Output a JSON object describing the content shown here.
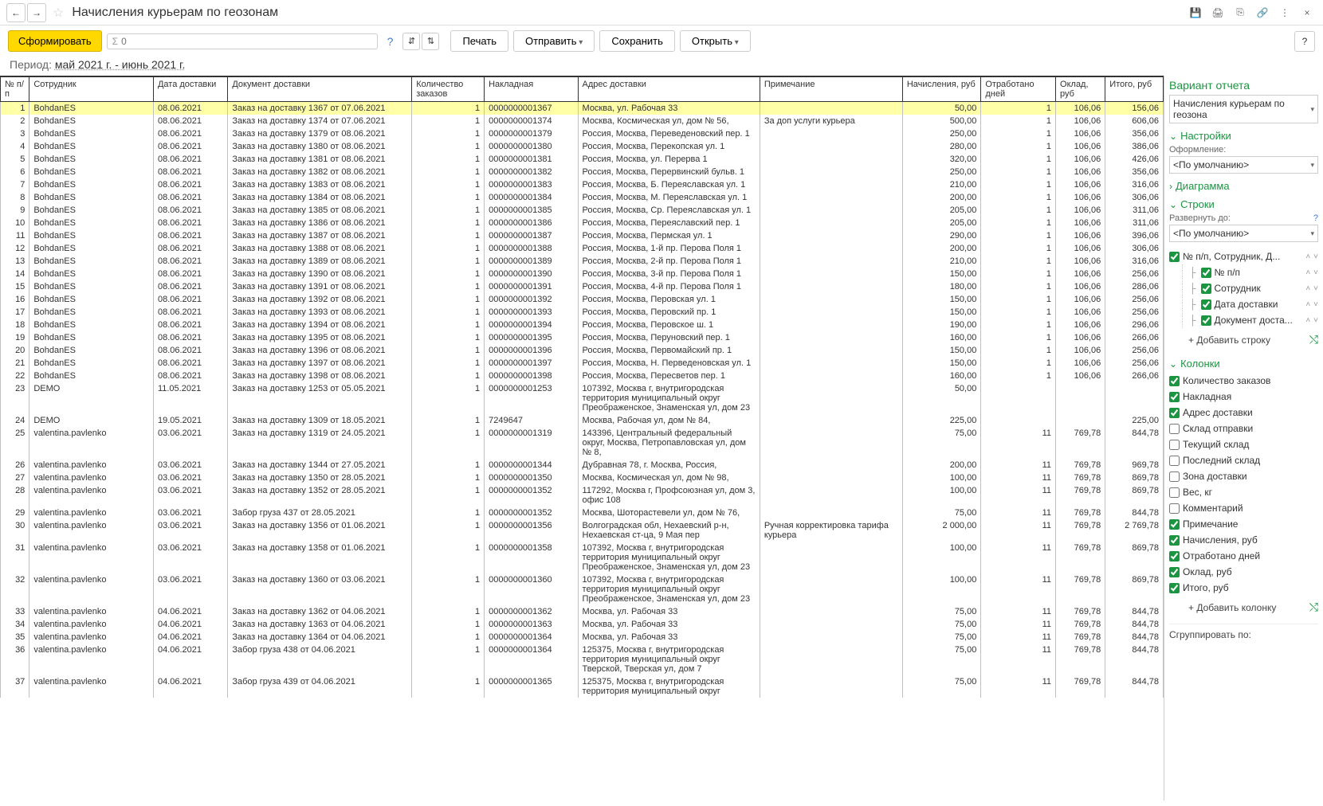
{
  "header": {
    "title": "Начисления курьерам по геозонам"
  },
  "toolbar": {
    "form": "Сформировать",
    "search_placeholder": "0",
    "print": "Печать",
    "send": "Отправить",
    "save": "Сохранить",
    "open": "Открыть"
  },
  "period": {
    "label": "Период:",
    "value": "май 2021 г. - июнь 2021 г."
  },
  "columns": {
    "num": "№ п/п",
    "emp": "Сотрудник",
    "date": "Дата доставки",
    "doc": "Документ доставки",
    "qty": "Количество заказов",
    "inv": "Накладная",
    "addr": "Адрес доставки",
    "note": "Примечание",
    "acc": "Начисления, руб",
    "days": "Отработано дней",
    "sal": "Оклад, руб",
    "total": "Итого, руб"
  },
  "rows": [
    {
      "n": 1,
      "emp": "BohdanES",
      "date": "08.06.2021",
      "doc": "Заказ на доставку 1367 от 07.06.2021",
      "qty": 1,
      "inv": "0000000001367",
      "addr": "Москва, ул. Рабочая 33",
      "note": "",
      "acc": "50,00",
      "days": 1,
      "sal": "106,06",
      "total": "156,06",
      "hl": true
    },
    {
      "n": 2,
      "emp": "BohdanES",
      "date": "08.06.2021",
      "doc": "Заказ на доставку 1374 от 07.06.2021",
      "qty": 1,
      "inv": "0000000001374",
      "addr": "Москва, Космическая ул, дом № 56,",
      "note": "За доп услуги курьера",
      "acc": "500,00",
      "days": 1,
      "sal": "106,06",
      "total": "606,06"
    },
    {
      "n": 3,
      "emp": "BohdanES",
      "date": "08.06.2021",
      "doc": "Заказ на доставку 1379 от 08.06.2021",
      "qty": 1,
      "inv": "0000000001379",
      "addr": "Россия, Москва, Переведеновский пер. 1",
      "note": "",
      "acc": "250,00",
      "days": 1,
      "sal": "106,06",
      "total": "356,06"
    },
    {
      "n": 4,
      "emp": "BohdanES",
      "date": "08.06.2021",
      "doc": "Заказ на доставку 1380 от 08.06.2021",
      "qty": 1,
      "inv": "0000000001380",
      "addr": "Россия, Москва, Перекопская ул. 1",
      "note": "",
      "acc": "280,00",
      "days": 1,
      "sal": "106,06",
      "total": "386,06"
    },
    {
      "n": 5,
      "emp": "BohdanES",
      "date": "08.06.2021",
      "doc": "Заказ на доставку 1381 от 08.06.2021",
      "qty": 1,
      "inv": "0000000001381",
      "addr": "Россия, Москва, ул. Перерва 1",
      "note": "",
      "acc": "320,00",
      "days": 1,
      "sal": "106,06",
      "total": "426,06"
    },
    {
      "n": 6,
      "emp": "BohdanES",
      "date": "08.06.2021",
      "doc": "Заказ на доставку 1382 от 08.06.2021",
      "qty": 1,
      "inv": "0000000001382",
      "addr": "Россия, Москва, Перервинский бульв. 1",
      "note": "",
      "acc": "250,00",
      "days": 1,
      "sal": "106,06",
      "total": "356,06"
    },
    {
      "n": 7,
      "emp": "BohdanES",
      "date": "08.06.2021",
      "doc": "Заказ на доставку 1383 от 08.06.2021",
      "qty": 1,
      "inv": "0000000001383",
      "addr": "Россия, Москва, Б. Переяславская ул. 1",
      "note": "",
      "acc": "210,00",
      "days": 1,
      "sal": "106,06",
      "total": "316,06"
    },
    {
      "n": 8,
      "emp": "BohdanES",
      "date": "08.06.2021",
      "doc": "Заказ на доставку 1384 от 08.06.2021",
      "qty": 1,
      "inv": "0000000001384",
      "addr": "Россия, Москва, М. Переяславская ул. 1",
      "note": "",
      "acc": "200,00",
      "days": 1,
      "sal": "106,06",
      "total": "306,06"
    },
    {
      "n": 9,
      "emp": "BohdanES",
      "date": "08.06.2021",
      "doc": "Заказ на доставку 1385 от 08.06.2021",
      "qty": 1,
      "inv": "0000000001385",
      "addr": "Россия, Москва, Ср. Переяславская ул. 1",
      "note": "",
      "acc": "205,00",
      "days": 1,
      "sal": "106,06",
      "total": "311,06"
    },
    {
      "n": 10,
      "emp": "BohdanES",
      "date": "08.06.2021",
      "doc": "Заказ на доставку 1386 от 08.06.2021",
      "qty": 1,
      "inv": "0000000001386",
      "addr": "Россия, Москва, Переяславский пер. 1",
      "note": "",
      "acc": "205,00",
      "days": 1,
      "sal": "106,06",
      "total": "311,06"
    },
    {
      "n": 11,
      "emp": "BohdanES",
      "date": "08.06.2021",
      "doc": "Заказ на доставку 1387 от 08.06.2021",
      "qty": 1,
      "inv": "0000000001387",
      "addr": "Россия, Москва, Пермская ул. 1",
      "note": "",
      "acc": "290,00",
      "days": 1,
      "sal": "106,06",
      "total": "396,06"
    },
    {
      "n": 12,
      "emp": "BohdanES",
      "date": "08.06.2021",
      "doc": "Заказ на доставку 1388 от 08.06.2021",
      "qty": 1,
      "inv": "0000000001388",
      "addr": "Россия, Москва, 1-й пр. Перова Поля 1",
      "note": "",
      "acc": "200,00",
      "days": 1,
      "sal": "106,06",
      "total": "306,06"
    },
    {
      "n": 13,
      "emp": "BohdanES",
      "date": "08.06.2021",
      "doc": "Заказ на доставку 1389 от 08.06.2021",
      "qty": 1,
      "inv": "0000000001389",
      "addr": "Россия, Москва, 2-й пр. Перова Поля 1",
      "note": "",
      "acc": "210,00",
      "days": 1,
      "sal": "106,06",
      "total": "316,06"
    },
    {
      "n": 14,
      "emp": "BohdanES",
      "date": "08.06.2021",
      "doc": "Заказ на доставку 1390 от 08.06.2021",
      "qty": 1,
      "inv": "0000000001390",
      "addr": "Россия, Москва, 3-й пр. Перова Поля 1",
      "note": "",
      "acc": "150,00",
      "days": 1,
      "sal": "106,06",
      "total": "256,06"
    },
    {
      "n": 15,
      "emp": "BohdanES",
      "date": "08.06.2021",
      "doc": "Заказ на доставку 1391 от 08.06.2021",
      "qty": 1,
      "inv": "0000000001391",
      "addr": "Россия, Москва, 4-й пр. Перова Поля 1",
      "note": "",
      "acc": "180,00",
      "days": 1,
      "sal": "106,06",
      "total": "286,06"
    },
    {
      "n": 16,
      "emp": "BohdanES",
      "date": "08.06.2021",
      "doc": "Заказ на доставку 1392 от 08.06.2021",
      "qty": 1,
      "inv": "0000000001392",
      "addr": "Россия, Москва, Перовская ул. 1",
      "note": "",
      "acc": "150,00",
      "days": 1,
      "sal": "106,06",
      "total": "256,06"
    },
    {
      "n": 17,
      "emp": "BohdanES",
      "date": "08.06.2021",
      "doc": "Заказ на доставку 1393 от 08.06.2021",
      "qty": 1,
      "inv": "0000000001393",
      "addr": "Россия, Москва, Перовский пр. 1",
      "note": "",
      "acc": "150,00",
      "days": 1,
      "sal": "106,06",
      "total": "256,06"
    },
    {
      "n": 18,
      "emp": "BohdanES",
      "date": "08.06.2021",
      "doc": "Заказ на доставку 1394 от 08.06.2021",
      "qty": 1,
      "inv": "0000000001394",
      "addr": "Россия, Москва, Перовское ш. 1",
      "note": "",
      "acc": "190,00",
      "days": 1,
      "sal": "106,06",
      "total": "296,06"
    },
    {
      "n": 19,
      "emp": "BohdanES",
      "date": "08.06.2021",
      "doc": "Заказ на доставку 1395 от 08.06.2021",
      "qty": 1,
      "inv": "0000000001395",
      "addr": "Россия, Москва, Перуновский пер. 1",
      "note": "",
      "acc": "160,00",
      "days": 1,
      "sal": "106,06",
      "total": "266,06"
    },
    {
      "n": 20,
      "emp": "BohdanES",
      "date": "08.06.2021",
      "doc": "Заказ на доставку 1396 от 08.06.2021",
      "qty": 1,
      "inv": "0000000001396",
      "addr": "Россия, Москва, Первомайский пр. 1",
      "note": "",
      "acc": "150,00",
      "days": 1,
      "sal": "106,06",
      "total": "256,06"
    },
    {
      "n": 21,
      "emp": "BohdanES",
      "date": "08.06.2021",
      "doc": "Заказ на доставку 1397 от 08.06.2021",
      "qty": 1,
      "inv": "0000000001397",
      "addr": "Россия, Москва, Н. Перведеновская ул. 1",
      "note": "",
      "acc": "150,00",
      "days": 1,
      "sal": "106,06",
      "total": "256,06"
    },
    {
      "n": 22,
      "emp": "BohdanES",
      "date": "08.06.2021",
      "doc": "Заказ на доставку 1398 от 08.06.2021",
      "qty": 1,
      "inv": "0000000001398",
      "addr": "Россия, Москва, Пересветов пер. 1",
      "note": "",
      "acc": "160,00",
      "days": 1,
      "sal": "106,06",
      "total": "266,06"
    },
    {
      "n": 23,
      "emp": "DEMO",
      "date": "11.05.2021",
      "doc": "Заказ на доставку 1253 от 05.05.2021",
      "qty": 1,
      "inv": "0000000001253",
      "addr": "107392, Москва г, внутригородская территория муниципальный округ Преображенское, Знаменская ул, дом 23",
      "note": "",
      "acc": "50,00",
      "days": "",
      "sal": "",
      "total": ""
    },
    {
      "n": 24,
      "emp": "DEMO",
      "date": "19.05.2021",
      "doc": "Заказ на доставку 1309 от 18.05.2021",
      "qty": 1,
      "inv": "7249647",
      "addr": "Москва, Рабочая ул, дом № 84,",
      "note": "",
      "acc": "225,00",
      "days": "",
      "sal": "",
      "total": "225,00"
    },
    {
      "n": 25,
      "emp": "valentina.pavlenko",
      "date": "03.06.2021",
      "doc": "Заказ на доставку 1319 от 24.05.2021",
      "qty": 1,
      "inv": "0000000001319",
      "addr": "143396, Центральный федеральный округ, Москва, Петропавловская ул, дом № 8,",
      "note": "",
      "acc": "75,00",
      "days": 11,
      "sal": "769,78",
      "total": "844,78"
    },
    {
      "n": 26,
      "emp": "valentina.pavlenko",
      "date": "03.06.2021",
      "doc": "Заказ на доставку 1344 от 27.05.2021",
      "qty": 1,
      "inv": "0000000001344",
      "addr": "Дубравная 78, г. Москва, Россия,",
      "note": "",
      "acc": "200,00",
      "days": 11,
      "sal": "769,78",
      "total": "969,78"
    },
    {
      "n": 27,
      "emp": "valentina.pavlenko",
      "date": "03.06.2021",
      "doc": "Заказ на доставку 1350 от 28.05.2021",
      "qty": 1,
      "inv": "0000000001350",
      "addr": "Москва, Космическая ул, дом № 98,",
      "note": "",
      "acc": "100,00",
      "days": 11,
      "sal": "769,78",
      "total": "869,78"
    },
    {
      "n": 28,
      "emp": "valentina.pavlenko",
      "date": "03.06.2021",
      "doc": "Заказ на доставку 1352 от 28.05.2021",
      "qty": 1,
      "inv": "0000000001352",
      "addr": "117292, Москва г, Профсоюзная ул, дом 3, офис 108",
      "note": "",
      "acc": "100,00",
      "days": 11,
      "sal": "769,78",
      "total": "869,78"
    },
    {
      "n": 29,
      "emp": "valentina.pavlenko",
      "date": "03.06.2021",
      "doc": "Забор груза 437 от 28.05.2021",
      "qty": 1,
      "inv": "0000000001352",
      "addr": "Москва, Шоторастевели ул, дом № 76,",
      "note": "",
      "acc": "75,00",
      "days": 11,
      "sal": "769,78",
      "total": "844,78"
    },
    {
      "n": 30,
      "emp": "valentina.pavlenko",
      "date": "03.06.2021",
      "doc": "Заказ на доставку 1356 от 01.06.2021",
      "qty": 1,
      "inv": "0000000001356",
      "addr": "Волгоградская обл, Нехаевский р-н, Нехаевская ст-ца, 9 Мая пер",
      "note": "Ручная корректировка тарифа курьера",
      "acc": "2 000,00",
      "days": 11,
      "sal": "769,78",
      "total": "2 769,78"
    },
    {
      "n": 31,
      "emp": "valentina.pavlenko",
      "date": "03.06.2021",
      "doc": "Заказ на доставку 1358 от 01.06.2021",
      "qty": 1,
      "inv": "0000000001358",
      "addr": "107392, Москва г, внутригородская территория муниципальный округ Преображенское, Знаменская ул, дом 23",
      "note": "",
      "acc": "100,00",
      "days": 11,
      "sal": "769,78",
      "total": "869,78"
    },
    {
      "n": 32,
      "emp": "valentina.pavlenko",
      "date": "03.06.2021",
      "doc": "Заказ на доставку 1360 от 03.06.2021",
      "qty": 1,
      "inv": "0000000001360",
      "addr": "107392, Москва г, внутригородская территория муниципальный округ Преображенское, Знаменская ул, дом 23",
      "note": "",
      "acc": "100,00",
      "days": 11,
      "sal": "769,78",
      "total": "869,78"
    },
    {
      "n": 33,
      "emp": "valentina.pavlenko",
      "date": "04.06.2021",
      "doc": "Заказ на доставку 1362 от 04.06.2021",
      "qty": 1,
      "inv": "0000000001362",
      "addr": "Москва, ул. Рабочая 33",
      "note": "",
      "acc": "75,00",
      "days": 11,
      "sal": "769,78",
      "total": "844,78"
    },
    {
      "n": 34,
      "emp": "valentina.pavlenko",
      "date": "04.06.2021",
      "doc": "Заказ на доставку 1363 от 04.06.2021",
      "qty": 1,
      "inv": "0000000001363",
      "addr": "Москва, ул. Рабочая 33",
      "note": "",
      "acc": "75,00",
      "days": 11,
      "sal": "769,78",
      "total": "844,78"
    },
    {
      "n": 35,
      "emp": "valentina.pavlenko",
      "date": "04.06.2021",
      "doc": "Заказ на доставку 1364 от 04.06.2021",
      "qty": 1,
      "inv": "0000000001364",
      "addr": "Москва, ул. Рабочая 33",
      "note": "",
      "acc": "75,00",
      "days": 11,
      "sal": "769,78",
      "total": "844,78"
    },
    {
      "n": 36,
      "emp": "valentina.pavlenko",
      "date": "04.06.2021",
      "doc": "Забор груза 438 от 04.06.2021",
      "qty": 1,
      "inv": "0000000001364",
      "addr": "125375, Москва г, внутригородская территория муниципальный округ Тверской, Тверская ул, дом 7",
      "note": "",
      "acc": "75,00",
      "days": 11,
      "sal": "769,78",
      "total": "844,78"
    },
    {
      "n": 37,
      "emp": "valentina.pavlenko",
      "date": "04.06.2021",
      "doc": "Забор груза 439 от 04.06.2021",
      "qty": 1,
      "inv": "0000000001365",
      "addr": "125375, Москва г, внутригородская территория муниципальный округ",
      "note": "",
      "acc": "75,00",
      "days": 11,
      "sal": "769,78",
      "total": "844,78"
    }
  ],
  "side": {
    "variant_title": "Вариант отчета",
    "variant_value": "Начисления курьерам по геозона",
    "settings_title": "Настройки",
    "design_label": "Оформление:",
    "design_value": "<По умолчанию>",
    "diagram_title": "Диаграмма",
    "rows_title": "Строки",
    "expand_label": "Развернуть до:",
    "expand_value": "<По умолчанию>",
    "group_root": "№ п/п, Сотрудник, Д...",
    "group_items": [
      "№ п/п",
      "Сотрудник",
      "Дата доставки",
      "Документ доста..."
    ],
    "add_row": "+ Добавить строку",
    "cols_title": "Колонки",
    "col_items": [
      {
        "label": "Количество заказов",
        "checked": true
      },
      {
        "label": "Накладная",
        "checked": true
      },
      {
        "label": "Адрес доставки",
        "checked": true
      },
      {
        "label": "Склад отправки",
        "checked": false
      },
      {
        "label": "Текущий склад",
        "checked": false
      },
      {
        "label": "Последний склад",
        "checked": false
      },
      {
        "label": "Зона доставки",
        "checked": false
      },
      {
        "label": "Вес, кг",
        "checked": false
      },
      {
        "label": "Комментарий",
        "checked": false
      },
      {
        "label": "Примечание",
        "checked": true
      },
      {
        "label": "Начисления, руб",
        "checked": true
      },
      {
        "label": "Отработано дней",
        "checked": true
      },
      {
        "label": "Оклад, руб",
        "checked": true
      },
      {
        "label": "Итого, руб",
        "checked": true
      }
    ],
    "add_col": "+ Добавить колонку",
    "group_by": "Сгруппировать по:"
  }
}
